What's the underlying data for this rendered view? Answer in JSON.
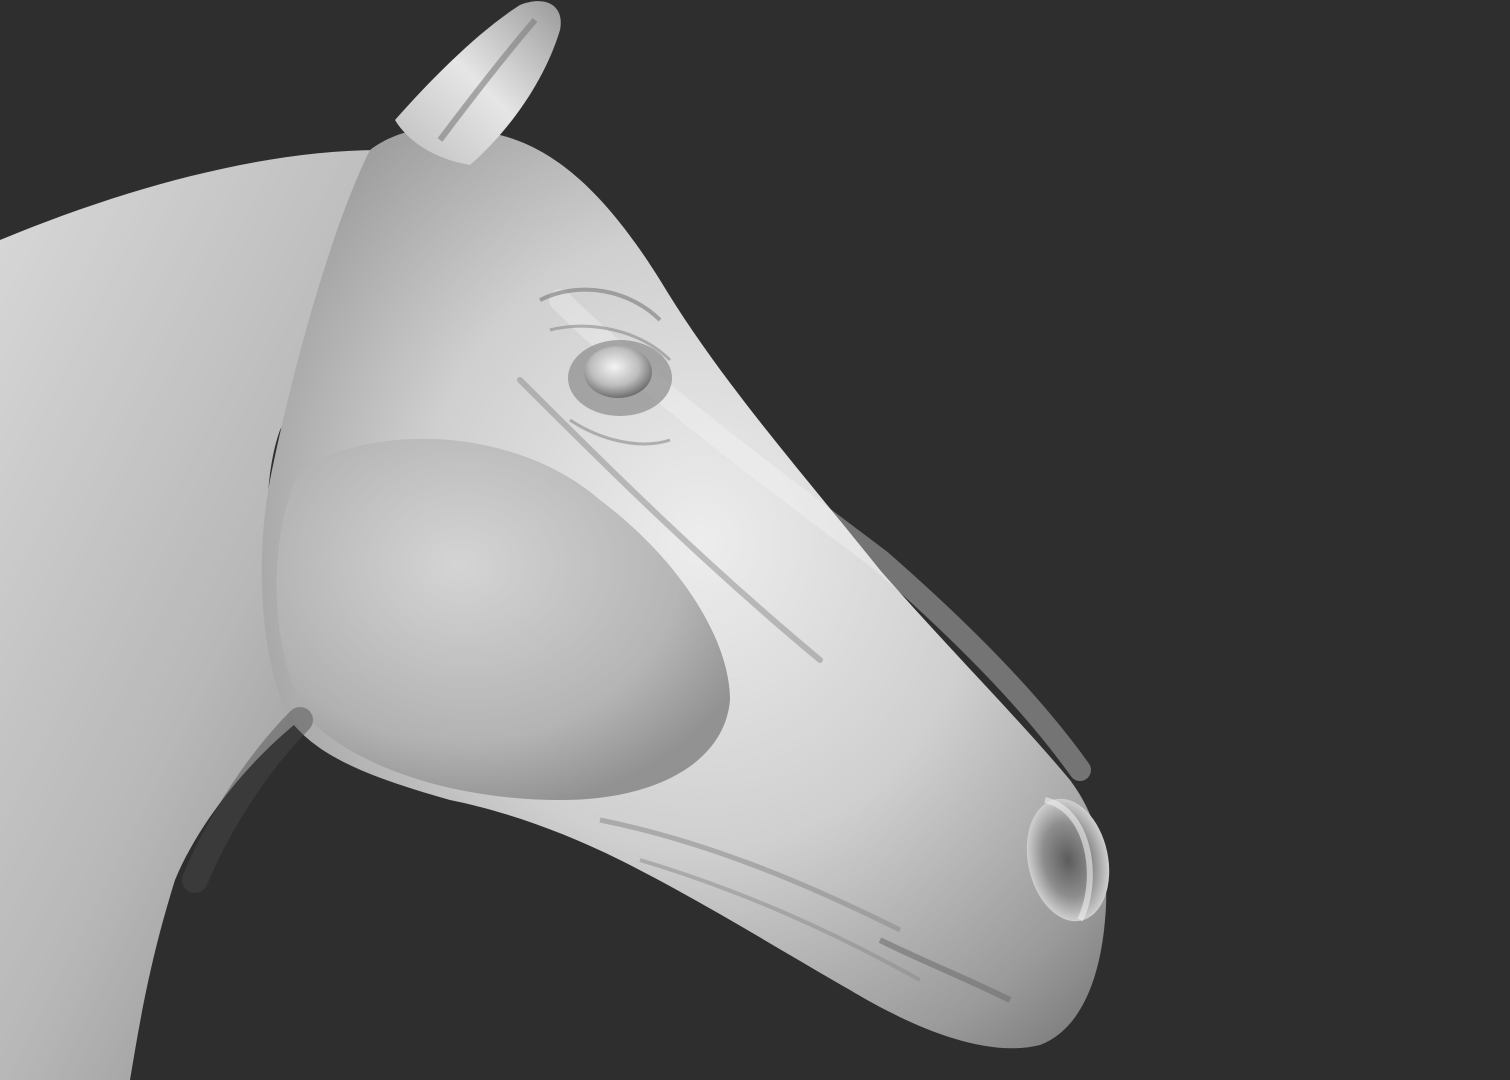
{
  "scene": {
    "subject": "horse-head-sculpt",
    "background_color": "#2e2e2f",
    "clay_color": "#c9c9c9",
    "clay_highlight": "#f2f2f2",
    "clay_shadow": "#5a5a5a"
  }
}
